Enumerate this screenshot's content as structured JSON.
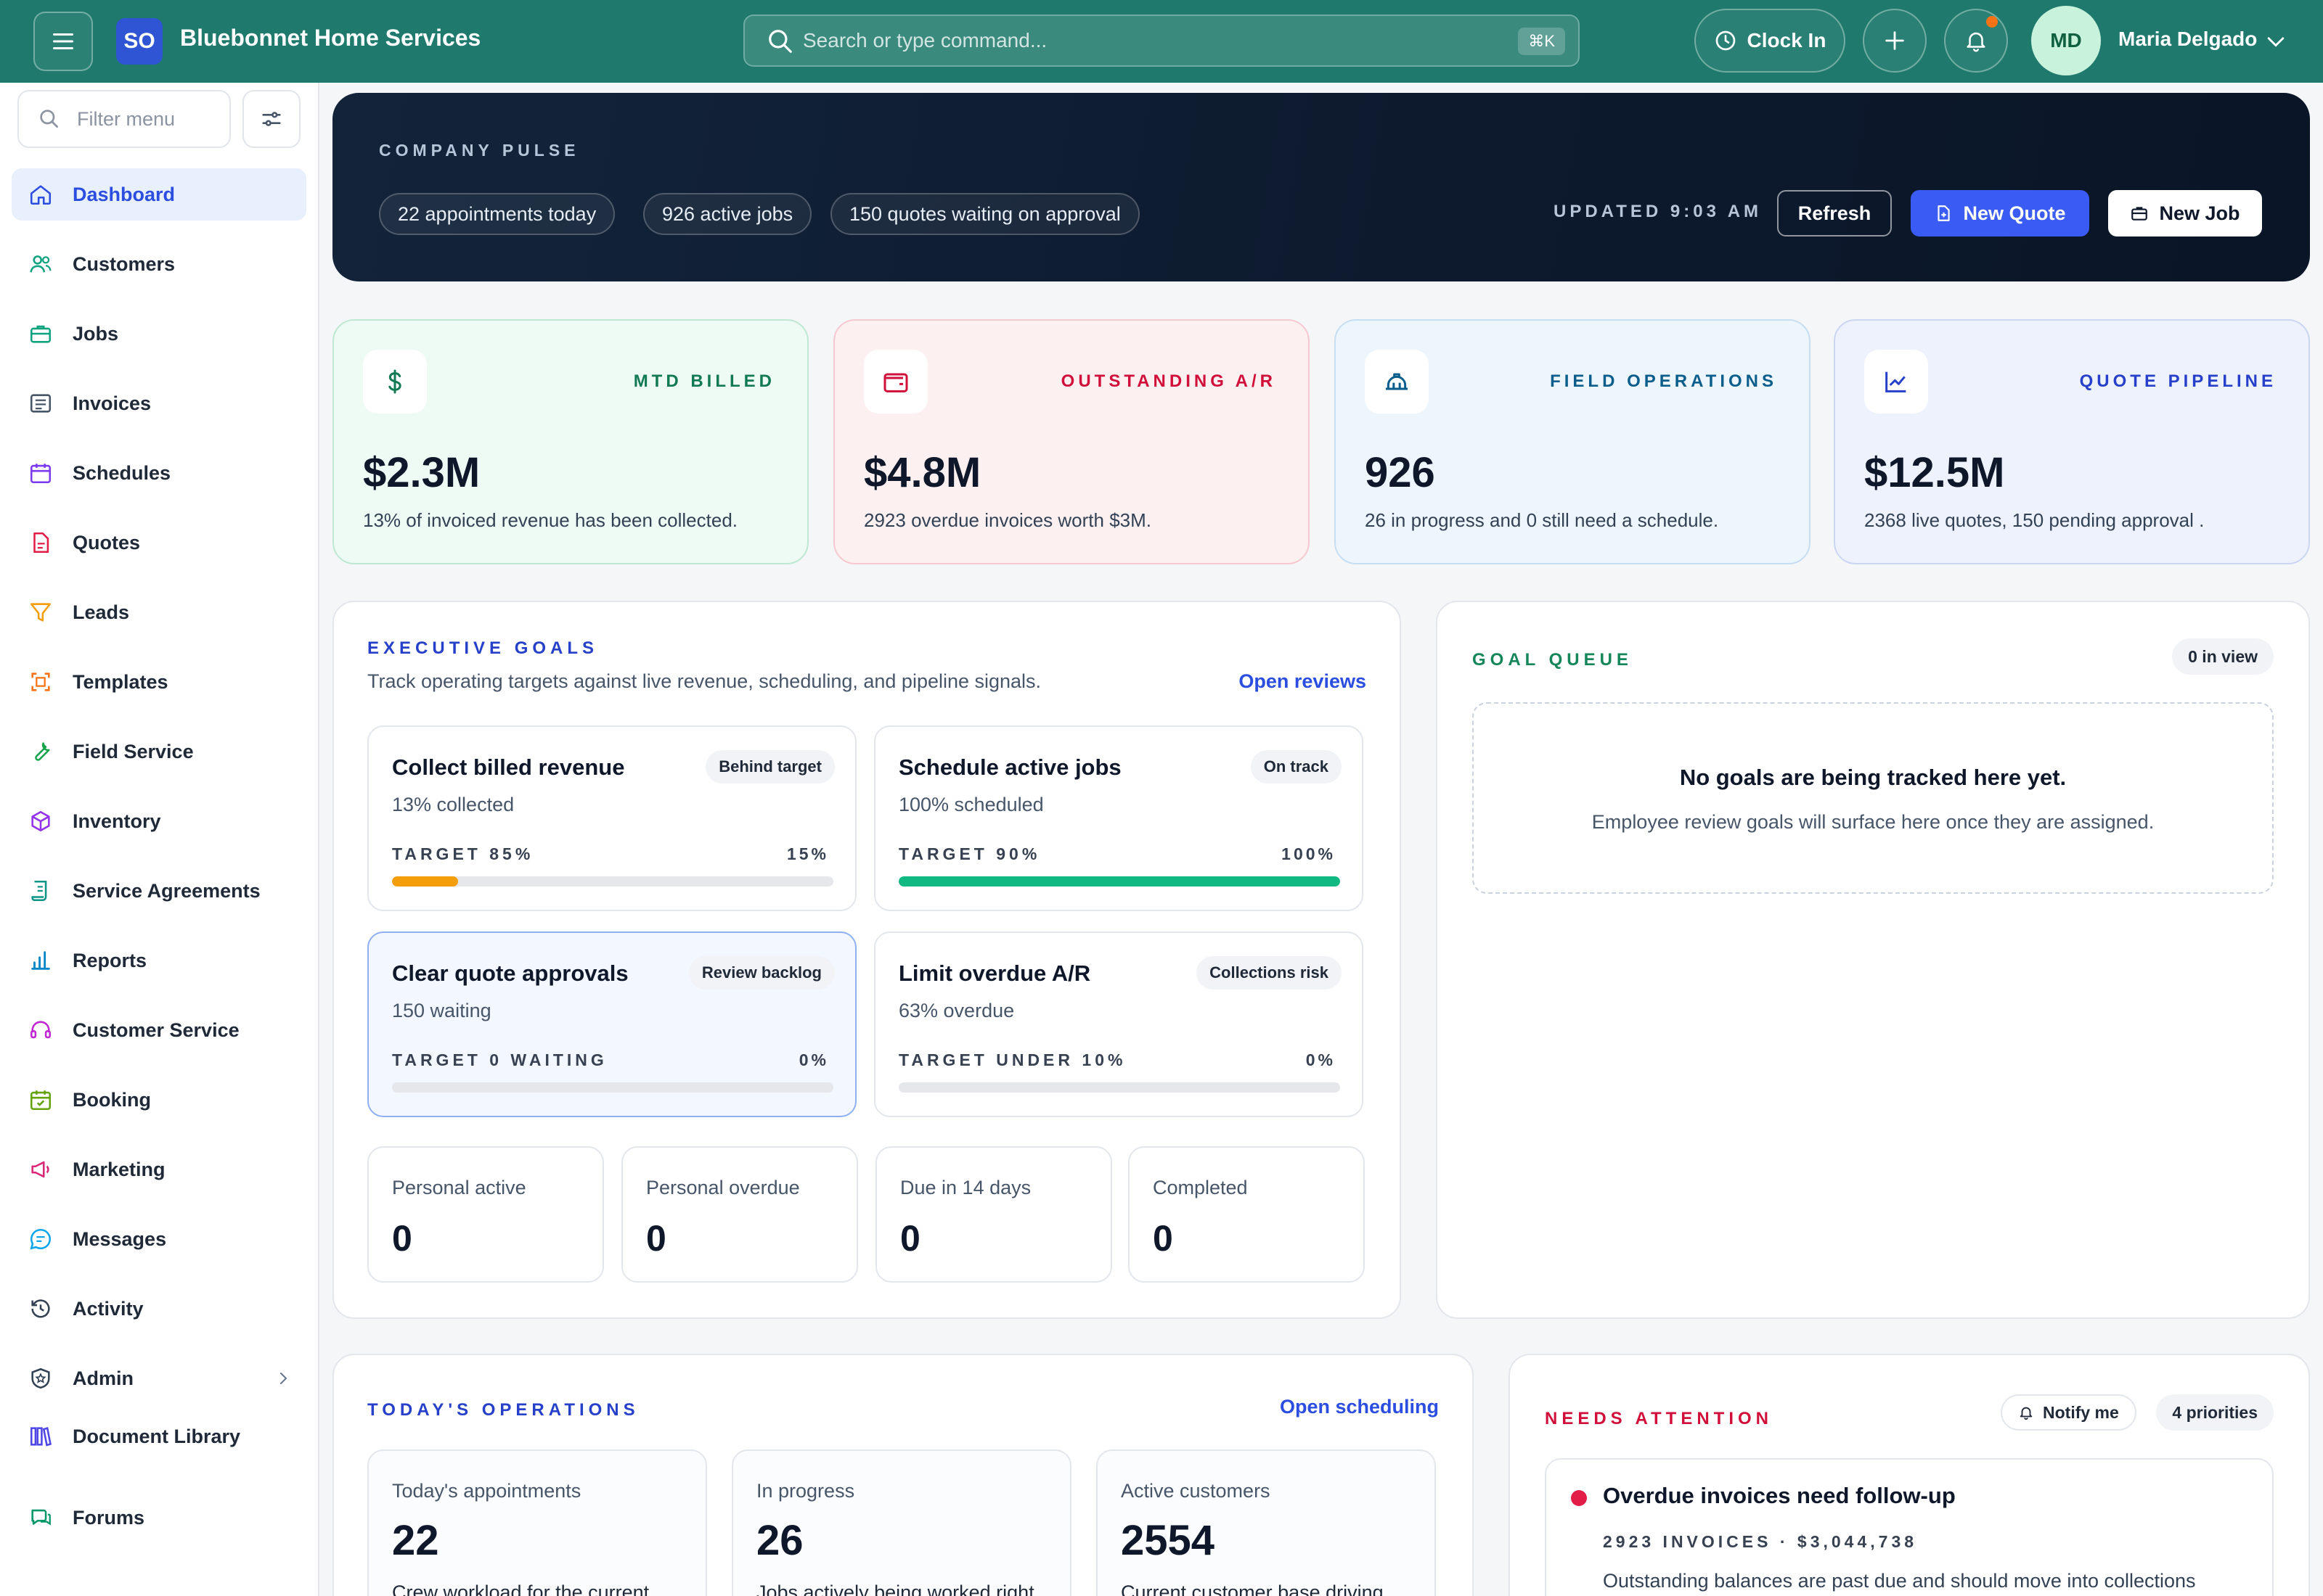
{
  "topbar": {
    "logo_initials": "SO",
    "brand_name": "Bluebonnet Home Services",
    "search_placeholder": "Search or type command...",
    "search_shortcut": "⌘K",
    "clock_in_label": "Clock In",
    "user_initials": "MD",
    "user_name": "Maria Delgado"
  },
  "sidebar": {
    "filter_placeholder": "Filter menu",
    "items": [
      {
        "label": "Dashboard",
        "icon": "home-icon",
        "active": true
      },
      {
        "label": "Customers",
        "icon": "users-icon"
      },
      {
        "label": "Jobs",
        "icon": "briefcase-icon"
      },
      {
        "label": "Invoices",
        "icon": "invoice-icon"
      },
      {
        "label": "Schedules",
        "icon": "calendar-icon"
      },
      {
        "label": "Quotes",
        "icon": "document-icon"
      },
      {
        "label": "Leads",
        "icon": "funnel-icon"
      },
      {
        "label": "Templates",
        "icon": "template-icon"
      },
      {
        "label": "Field Service",
        "icon": "wrench-icon"
      },
      {
        "label": "Inventory",
        "icon": "box-icon"
      },
      {
        "label": "Service Agreements",
        "icon": "scroll-icon"
      },
      {
        "label": "Reports",
        "icon": "bar-chart-icon"
      },
      {
        "label": "Customer Service",
        "icon": "headset-icon"
      },
      {
        "label": "Booking",
        "icon": "calendar-check-icon"
      },
      {
        "label": "Marketing",
        "icon": "megaphone-icon"
      },
      {
        "label": "Messages",
        "icon": "chat-icon"
      },
      {
        "label": "Activity",
        "icon": "history-icon"
      },
      {
        "label": "Admin",
        "icon": "shield-icon"
      },
      {
        "label": "Document Library",
        "icon": "library-icon"
      },
      {
        "label": "Forums",
        "icon": "forum-icon"
      }
    ]
  },
  "hero": {
    "label": "COMPANY PULSE",
    "chips": [
      "22 appointments today",
      "926 active jobs",
      "150 quotes waiting on approval"
    ],
    "updated": "UPDATED 9:03 AM",
    "refresh_label": "Refresh",
    "new_quote_label": "New Quote",
    "new_job_label": "New Job"
  },
  "kpis": [
    {
      "label": "MTD BILLED",
      "value": "$2.3M",
      "sub": "13% of invoiced revenue has been collected.",
      "accent": "#127a52",
      "bg": "#eefaf4",
      "border": "#bfe8d3",
      "icon": "dollar-icon"
    },
    {
      "label": "OUTSTANDING A/R",
      "value": "$4.8M",
      "sub": "2923 overdue invoices worth $3M.",
      "accent": "#d0103a",
      "bg": "#fdf0f1",
      "border": "#f5c9cf",
      "icon": "wallet-icon"
    },
    {
      "label": "FIELD OPERATIONS",
      "value": "926",
      "sub": "26 in progress and 0 still need a schedule.",
      "accent": "#0b5d8c",
      "bg": "#eef6fd",
      "border": "#c6def2",
      "icon": "hardhat-icon"
    },
    {
      "label": "QUOTE PIPELINE",
      "value": "$12.5M",
      "sub": "2368 live quotes, 150 pending approval .",
      "accent": "#2640c9",
      "bg": "#eef2fc",
      "border": "#cbd6f3",
      "icon": "trend-icon"
    }
  ],
  "exec_goals": {
    "label": "EXECUTIVE GOALS",
    "desc": "Track operating targets against live revenue, scheduling, and pipeline signals.",
    "link": "Open reviews",
    "goals": [
      {
        "title": "Collect billed revenue",
        "sub": "13% collected",
        "badge": "Behind target",
        "target": "TARGET 85%",
        "pct": "15%",
        "progress": 15,
        "color": "#f59e0b"
      },
      {
        "title": "Schedule active jobs",
        "sub": "100% scheduled",
        "badge": "On track",
        "target": "TARGET 90%",
        "pct": "100%",
        "progress": 100,
        "color": "#10b981"
      },
      {
        "title": "Clear quote approvals",
        "sub": "150 waiting",
        "badge": "Review backlog",
        "target": "TARGET 0 WAITING",
        "pct": "0%",
        "progress": 0,
        "color": "#3b82f6"
      },
      {
        "title": "Limit overdue A/R",
        "sub": "63% overdue",
        "badge": "Collections risk",
        "target": "TARGET UNDER 10%",
        "pct": "0%",
        "progress": 0,
        "color": "#ef4444"
      }
    ],
    "stats": [
      {
        "label": "Personal active",
        "value": "0"
      },
      {
        "label": "Personal overdue",
        "value": "0"
      },
      {
        "label": "Due in 14 days",
        "value": "0"
      },
      {
        "label": "Completed",
        "value": "0"
      }
    ]
  },
  "goal_queue": {
    "label": "GOAL QUEUE",
    "count": "0 in view",
    "empty_title": "No goals are being tracked here yet.",
    "empty_sub": "Employee review goals will surface here once they are assigned."
  },
  "operations": {
    "label": "TODAY'S OPERATIONS",
    "link": "Open scheduling",
    "cards": [
      {
        "label": "Today's appointments",
        "value": "22",
        "desc": "Crew workload for the current"
      },
      {
        "label": "In progress",
        "value": "26",
        "desc": "Jobs actively being worked right"
      },
      {
        "label": "Active customers",
        "value": "2554",
        "desc": "Current customer base driving"
      }
    ]
  },
  "attention": {
    "label": "NEEDS ATTENTION",
    "notify_label": "Notify me",
    "priorities": "4 priorities",
    "item": {
      "title": "Overdue invoices need follow-up",
      "meta": "2923 INVOICES · $3,044,738",
      "desc": "Outstanding balances are past due and should move into collections"
    }
  }
}
